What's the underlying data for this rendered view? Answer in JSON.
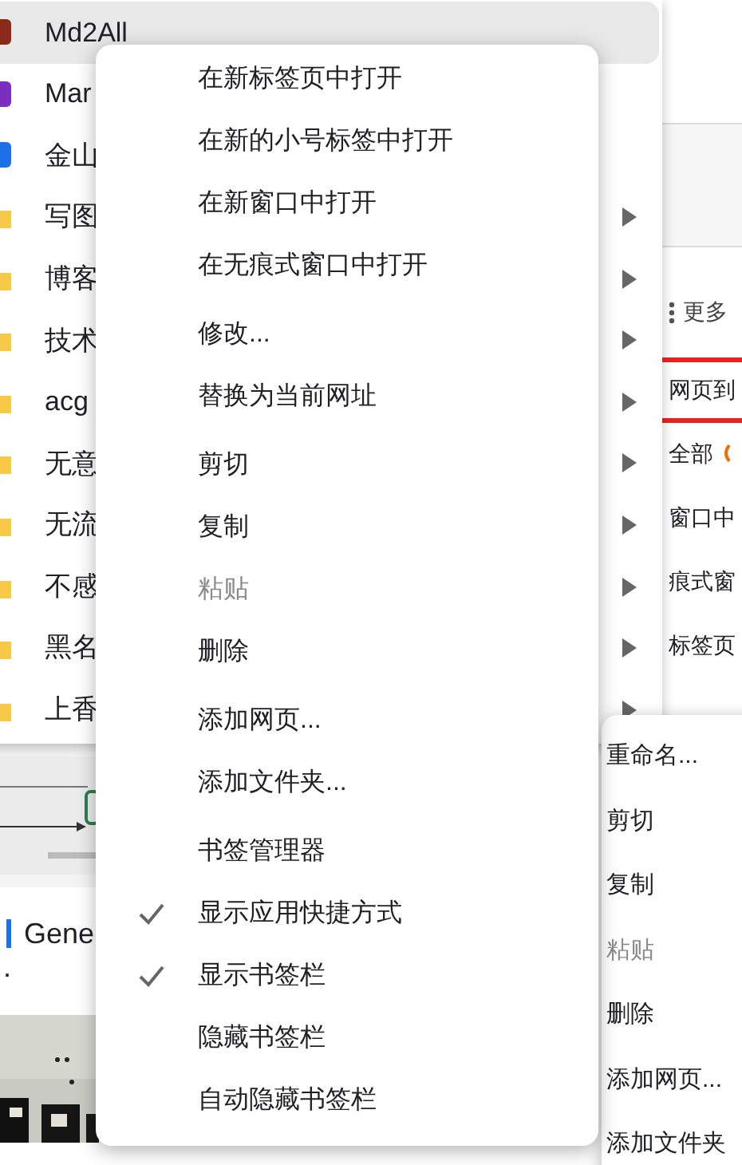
{
  "page": {
    "more_button": "更多",
    "right_items": [
      {
        "label": "网页到",
        "highlighted": true
      },
      {
        "label": "全部",
        "highlighted": false
      },
      {
        "label": "窗口中",
        "highlighted": false
      },
      {
        "label": "痕式窗",
        "highlighted": false
      },
      {
        "label": "标签页",
        "highlighted": false
      }
    ],
    "article_text": "Gene",
    "article_text_2": "."
  },
  "bookmark_folder_menu": {
    "items": [
      {
        "label": "Md2All",
        "kind": "page",
        "color": "#8b2a1a",
        "selected": true
      },
      {
        "label": "Mar",
        "kind": "page",
        "color": "#7b2fbf",
        "selected": false
      },
      {
        "label": "金山",
        "kind": "page",
        "color": "#1e6fe8",
        "selected": false
      },
      {
        "label": "写图",
        "kind": "folder",
        "selected": false
      },
      {
        "label": "博客",
        "kind": "folder",
        "selected": false
      },
      {
        "label": "技术",
        "kind": "folder",
        "selected": false
      },
      {
        "label": "acg",
        "kind": "folder",
        "selected": false
      },
      {
        "label": "无意",
        "kind": "folder",
        "selected": false
      },
      {
        "label": "无流",
        "kind": "folder",
        "selected": false
      },
      {
        "label": "不感",
        "kind": "folder",
        "selected": false
      },
      {
        "label": "黑名",
        "kind": "folder",
        "selected": false
      },
      {
        "label": "上香",
        "kind": "folder",
        "selected": false
      }
    ]
  },
  "background_menu": {
    "items": [
      {
        "label": "重命名...",
        "disabled": false
      },
      {
        "label": "剪切",
        "disabled": false
      },
      {
        "label": "复制",
        "disabled": false
      },
      {
        "label": "粘贴",
        "disabled": true
      },
      {
        "label": "删除",
        "disabled": false
      },
      {
        "label": "添加网页...",
        "disabled": false
      },
      {
        "label": "添加文件夹",
        "disabled": false
      }
    ]
  },
  "context_menu": {
    "groups": [
      [
        {
          "label": "在新标签页中打开",
          "disabled": false,
          "checked": false
        },
        {
          "label": "在新的小号标签中打开",
          "disabled": false,
          "checked": false
        },
        {
          "label": "在新窗口中打开",
          "disabled": false,
          "checked": false
        },
        {
          "label": "在无痕式窗口中打开",
          "disabled": false,
          "checked": false
        }
      ],
      [
        {
          "label": "修改...",
          "disabled": false,
          "checked": false
        },
        {
          "label": "替换为当前网址",
          "disabled": false,
          "checked": false
        }
      ],
      [
        {
          "label": "剪切",
          "disabled": false,
          "checked": false
        },
        {
          "label": "复制",
          "disabled": false,
          "checked": false
        },
        {
          "label": "粘贴",
          "disabled": true,
          "checked": false
        },
        {
          "label": "删除",
          "disabled": false,
          "checked": false
        }
      ],
      [
        {
          "label": "添加网页...",
          "disabled": false,
          "checked": false
        },
        {
          "label": "添加文件夹...",
          "disabled": false,
          "checked": false
        }
      ],
      [
        {
          "label": "书签管理器",
          "disabled": false,
          "checked": false
        },
        {
          "label": "显示应用快捷方式",
          "disabled": false,
          "checked": true
        },
        {
          "label": "显示书签栏",
          "disabled": false,
          "checked": true
        },
        {
          "label": "隐藏书签栏",
          "disabled": false,
          "checked": false
        },
        {
          "label": "自动隐藏书签栏",
          "disabled": false,
          "checked": false
        }
      ]
    ]
  }
}
